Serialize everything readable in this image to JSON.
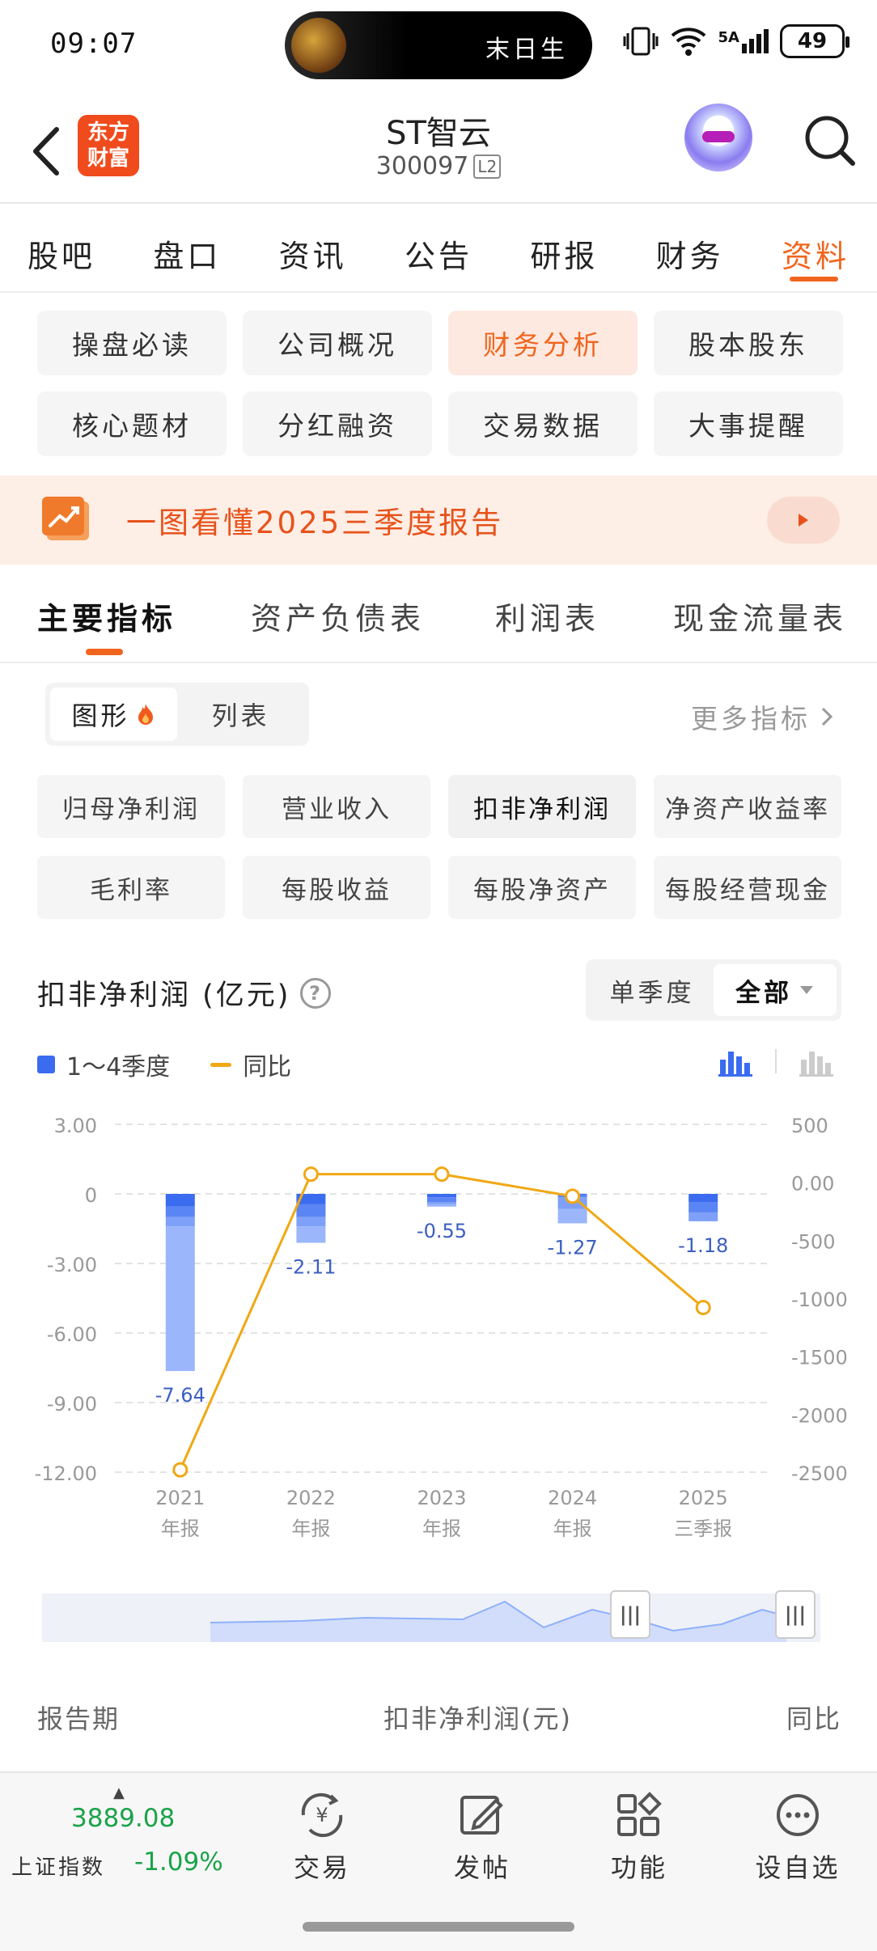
{
  "status_bar": {
    "time": "09:07",
    "pill_text": "末日生",
    "network": "5A",
    "battery": "49"
  },
  "header": {
    "logo_text": "东方\n财富",
    "stock_name": "ST智云",
    "stock_code": "300097",
    "level_badge": "L2"
  },
  "main_tabs": [
    {
      "label": "股吧"
    },
    {
      "label": "盘口"
    },
    {
      "label": "资讯"
    },
    {
      "label": "公告"
    },
    {
      "label": "研报"
    },
    {
      "label": "财务"
    },
    {
      "label": "资料",
      "active": true
    }
  ],
  "sub_nav": [
    {
      "label": "操盘必读"
    },
    {
      "label": "公司概况"
    },
    {
      "label": "财务分析",
      "active": true
    },
    {
      "label": "股本股东"
    },
    {
      "label": "核心题材"
    },
    {
      "label": "分红融资"
    },
    {
      "label": "交易数据"
    },
    {
      "label": "大事提醒"
    }
  ],
  "banner": {
    "text": "一图看懂2025三季度报告"
  },
  "section_tabs": [
    {
      "label": "主要指标",
      "active": true
    },
    {
      "label": "资产负债表"
    },
    {
      "label": "利润表"
    },
    {
      "label": "现金流量表"
    }
  ],
  "view_toggle": {
    "graph": "图形",
    "list": "列表",
    "more": "更多指标"
  },
  "metrics": [
    {
      "label": "归母净利润"
    },
    {
      "label": "营业收入"
    },
    {
      "label": "扣非净利润",
      "active": true
    },
    {
      "label": "净资产收益率"
    },
    {
      "label": "毛利率"
    },
    {
      "label": "每股收益"
    },
    {
      "label": "每股净资产"
    },
    {
      "label": "每股经营现金"
    }
  ],
  "chart_header": {
    "title": "扣非净利润 (亿元)",
    "help": "?",
    "period_single": "单季度",
    "period_all": "全部"
  },
  "legend": {
    "bars": "1～4季度",
    "line": "同比"
  },
  "colors": {
    "accent": "#f0651d",
    "bar_dark": "#3b6cf0",
    "bar_light": "#8fb0fb",
    "line": "#f0a815",
    "down": "#1aa34a"
  },
  "chart_data": {
    "type": "bar",
    "title": "扣非净利润 (亿元)",
    "categories": [
      "2021\n年报",
      "2022\n年报",
      "2023\n年报",
      "2024\n年报",
      "2025\n三季报"
    ],
    "category_years": [
      "2021",
      "2022",
      "2023",
      "2024",
      "2025"
    ],
    "category_periods": [
      "年报",
      "年报",
      "年报",
      "年报",
      "三季报"
    ],
    "series": [
      {
        "name": "1～4季度",
        "values": [
          -7.64,
          -2.11,
          -0.55,
          -1.27,
          -1.18
        ],
        "quarter_stack": [
          [
            -0.55,
            -0.45,
            -0.4,
            -6.24
          ],
          [
            -0.45,
            -0.55,
            -0.4,
            -0.71
          ],
          [
            -0.15,
            -0.2,
            -0.1,
            -0.1
          ],
          [
            -0.05,
            -0.1,
            -0.5,
            -0.62
          ],
          [
            -0.35,
            -0.45,
            -0.38
          ]
        ]
      },
      {
        "name": "同比",
        "axis": "right",
        "type": "line",
        "values": [
          -2480,
          70,
          70,
          -120,
          -1080
        ]
      }
    ],
    "value_labels": [
      "-7.64",
      "-2.11",
      "-0.55",
      "-1.27",
      "-1.18"
    ],
    "left_ticks": [
      "3.00",
      "0",
      "-3.00",
      "-6.00",
      "-9.00",
      "-12.00"
    ],
    "right_ticks": [
      "500",
      "0.00",
      "-500",
      "-1000",
      "-1500",
      "-2000",
      "-2500"
    ],
    "ylim": [
      -12,
      3
    ],
    "y2lim": [
      -2500,
      500
    ]
  },
  "table": {
    "col_period": "报告期",
    "col_value": "扣非净利润(元)",
    "col_yoy": "同比"
  },
  "bottom_bar": {
    "index_value": "3889.08",
    "index_name": "上证指数",
    "index_change": "-1.09%",
    "items": [
      {
        "label": "交易",
        "icon": "trade-icon"
      },
      {
        "label": "发帖",
        "icon": "post-icon"
      },
      {
        "label": "功能",
        "icon": "grid-icon"
      },
      {
        "label": "设自选",
        "icon": "more-icon"
      }
    ]
  }
}
